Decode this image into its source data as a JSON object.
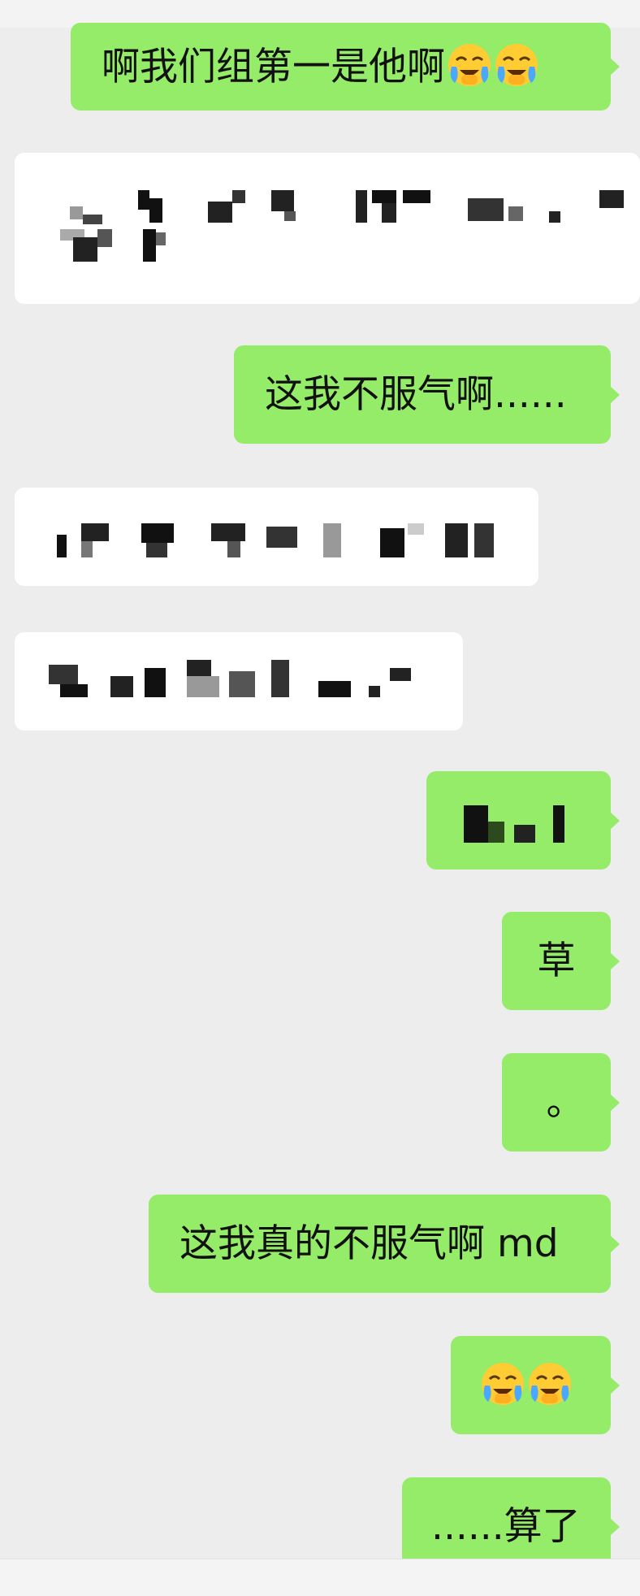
{
  "messages": [
    {
      "side": "out",
      "text": "啊我们组第一是他啊",
      "emojis": [
        "face-with-tears-icon",
        "face-with-tears-icon"
      ]
    },
    {
      "side": "in",
      "redacted": true
    },
    {
      "side": "out",
      "text": "这我不服气啊......"
    },
    {
      "side": "in",
      "redacted": true
    },
    {
      "side": "in",
      "redacted": true
    },
    {
      "side": "out",
      "redacted": true
    },
    {
      "side": "out",
      "text": "草"
    },
    {
      "side": "out",
      "text": "。"
    },
    {
      "side": "out",
      "text": "这我真的不服气啊 md"
    },
    {
      "side": "out",
      "text": "",
      "emojis": [
        "face-with-tears-icon",
        "face-with-tears-icon"
      ]
    },
    {
      "side": "out",
      "text": "......算了"
    }
  ],
  "colors": {
    "background": "#ededed",
    "outgoing_bubble": "#95ec69",
    "incoming_bubble": "#ffffff",
    "text": "#111111"
  }
}
